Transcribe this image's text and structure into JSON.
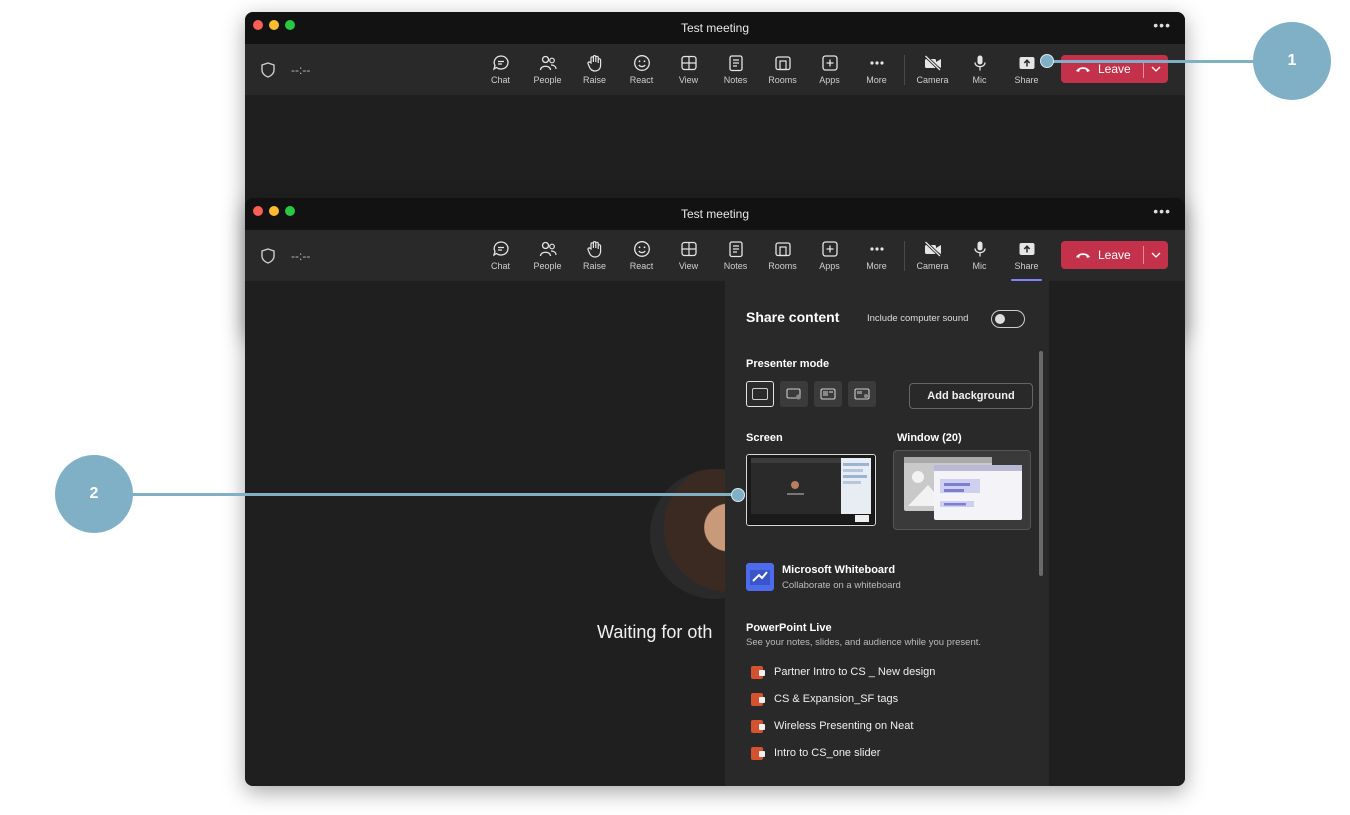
{
  "window_title": "Test meeting",
  "window_menu": "•••",
  "timer": "--:--",
  "toolbar": [
    {
      "id": "chat",
      "label": "Chat"
    },
    {
      "id": "people",
      "label": "People"
    },
    {
      "id": "raise",
      "label": "Raise"
    },
    {
      "id": "react",
      "label": "React"
    },
    {
      "id": "view",
      "label": "View"
    },
    {
      "id": "notes",
      "label": "Notes"
    },
    {
      "id": "rooms",
      "label": "Rooms"
    },
    {
      "id": "apps",
      "label": "Apps"
    },
    {
      "id": "more",
      "label": "More"
    },
    {
      "id": "camera",
      "label": "Camera"
    },
    {
      "id": "mic",
      "label": "Mic"
    },
    {
      "id": "share",
      "label": "Share"
    }
  ],
  "leave_label": "Leave",
  "waiting_text": "Waiting for oth",
  "share_panel": {
    "title": "Share content",
    "include_sound_label": "Include computer sound",
    "include_sound_on": false,
    "presenter_mode_label": "Presenter mode",
    "add_background_label": "Add background",
    "screen_label": "Screen",
    "window_label": "Window (20)",
    "whiteboard": {
      "title": "Microsoft Whiteboard",
      "subtitle": "Collaborate on a whiteboard"
    },
    "powerpoint": {
      "title": "PowerPoint Live",
      "subtitle": "See your notes, slides, and audience while you present.",
      "files": [
        "Partner Intro to CS _ New design",
        "CS & Expansion_SF tags",
        "Wireless Presenting on Neat",
        "Intro to CS_one slider"
      ]
    }
  },
  "callouts": [
    "1",
    "2"
  ],
  "colors": {
    "leave": "#c4314b",
    "accent": "#7f85f5",
    "callout": "#7fb0c6",
    "window_bg": "#1f1f1f",
    "toolbar_bg": "#292929"
  }
}
